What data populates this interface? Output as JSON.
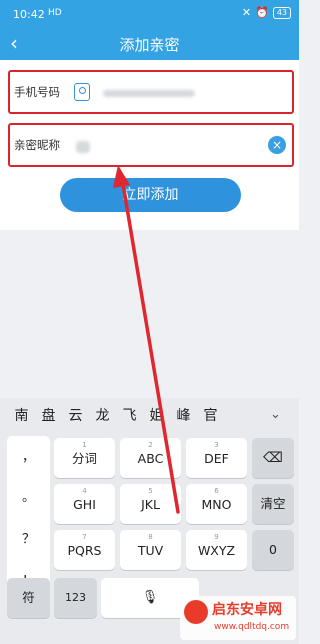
{
  "status": {
    "time": "10:42",
    "signal": "HD",
    "battery": "43"
  },
  "nav": {
    "title": "添加亲密"
  },
  "form": {
    "phone_label": "手机号码",
    "nickname_label": "亲密昵称",
    "submit_label": "立即添加"
  },
  "keyboard": {
    "candidates": [
      "南",
      "盘",
      "云",
      "龙",
      "飞",
      "姐",
      "峰",
      "官"
    ],
    "left_column": [
      "，",
      "。",
      "？",
      "！"
    ],
    "keys": {
      "k1": {
        "sub": "1",
        "main": "分词"
      },
      "k2": {
        "sub": "2",
        "main": "ABC"
      },
      "k3": {
        "sub": "3",
        "main": "DEF"
      },
      "k4": {
        "sub": "4",
        "main": "GHI"
      },
      "k5": {
        "sub": "5",
        "main": "JKL"
      },
      "k6": {
        "sub": "6",
        "main": "MNO"
      },
      "k7": {
        "sub": "7",
        "main": "PQRS"
      },
      "k8": {
        "sub": "8",
        "main": "TUV"
      },
      "k9": {
        "sub": "9",
        "main": "WXYZ"
      },
      "k0": {
        "main": "0"
      },
      "clear": "清空",
      "symbol": "符",
      "num": "123"
    }
  },
  "watermark": {
    "title": "启东安卓网",
    "url": "www.qdltdq.com"
  },
  "colors": {
    "header": "#34a3e3",
    "highlight": "#d9252c",
    "button": "#2e92dc"
  }
}
